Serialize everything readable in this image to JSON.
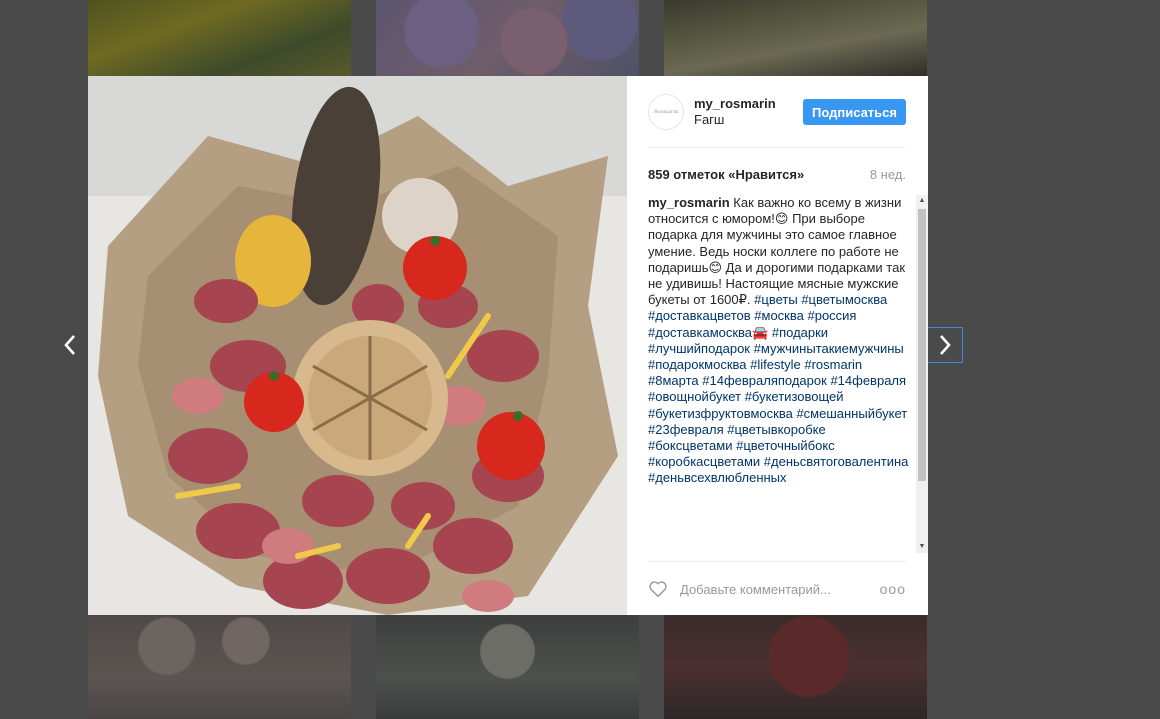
{
  "post": {
    "username": "my_rosmarin",
    "location": "Fагш",
    "avatar_text": "Rosmarin",
    "follow_label": "Подписаться",
    "likes": "859 отметок «Нравится»",
    "age": "8 нед.",
    "caption_user": "my_rosmarin",
    "caption_text": "Как важно ко всему в жизни относится с юмором!😊 При выборе подарка для мужчины это самое главное умение. Ведь носки коллеге по работе не подаришь😊 Да и дорогими подарками так не удивишь! Настоящие мясные мужские букеты от 1600₽.",
    "hashtags": [
      "#цветы",
      "#цветымосква",
      "#доставкацветов",
      "#москва",
      "#россия",
      "#доставкамосква🚘",
      "#подарки",
      "#лучшийподарок",
      "#мужчинытакиемужчины",
      "#подарокмосква",
      "#lifestyle",
      "#rosmarin",
      "#8марта",
      "#14февраляподарок",
      "#14февраля",
      "#овощнойбукет",
      "#букетизовощей",
      "#букетизфруктовмосква",
      "#смешанныйбукет",
      "#23февраля",
      "#цветывкоробке",
      "#боксцветами",
      "#цветочныйбокс",
      "#коробкасцветами",
      "#деньсвятоговалентина",
      "#деньвсехвлюбленных"
    ],
    "comment_placeholder": "Добавьте комментарий...",
    "more_label": "ooo"
  },
  "icons": {
    "prev": "chevron-left-icon",
    "next": "chevron-right-icon",
    "like": "heart-icon",
    "more": "more-options-icon"
  },
  "colors": {
    "follow_button": "#3897f0",
    "hashtag": "#003569",
    "overlay": "#4a4a4a"
  }
}
